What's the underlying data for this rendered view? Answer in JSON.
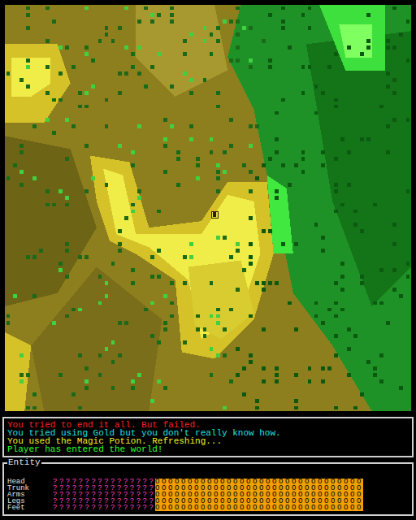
{
  "map": {
    "player": {
      "x": 32,
      "y": 32
    }
  },
  "messages": [
    {
      "text": "You tried to end it all. But failed.",
      "color": "#ff2020"
    },
    {
      "text": "You tried using Gold but you don't really know how.",
      "color": "#20e0e0"
    },
    {
      "text": "You used the Magic Potion. Refreshing...",
      "color": "#f0f020"
    },
    {
      "text": "Player has entered the world!",
      "color": "#30ff30"
    }
  ],
  "entity": {
    "title": "Entity",
    "parts": [
      {
        "label": "Head",
        "unknown": "????????????????",
        "bar": "OOOOOOOOOOOOOOOOOOOOOOOOOOOOOOOO"
      },
      {
        "label": "Trunk",
        "unknown": "????????????????",
        "bar": "OOOOOOOOOOOOOOOOOOOOOOOOOOOOOOOO"
      },
      {
        "label": "Arms",
        "unknown": "????????????????",
        "bar": "OOOOOOOOOOOOOOOOOOOOOOOOOOOOOOOO"
      },
      {
        "label": "Legs",
        "unknown": "????????????????",
        "bar": "OOOOOOOOOOOOOOOOOOOOOOOOOOOOOOOO"
      },
      {
        "label": "Feet",
        "unknown": "????????????????",
        "bar": "OOOOOOOOOOOOOOOOOOOOOOOOOOOOOOOO"
      }
    ]
  }
}
